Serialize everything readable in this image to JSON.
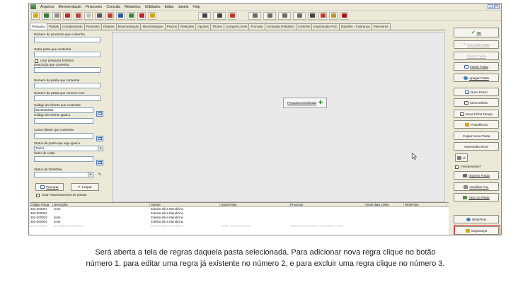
{
  "menu": [
    "Arquivos",
    "Movimentação",
    "Financeiro",
    "Consulta",
    "Relatórios",
    "Utilidades",
    "Editar",
    "Janela",
    "Help"
  ],
  "window_buttons": [
    "_",
    "□"
  ],
  "tabs": [
    "Pesquisa",
    "Pastas",
    "Complemento",
    "Processo",
    "Objetos",
    "Movimentação",
    "Mov.Destaque",
    "Prazos",
    "Relações",
    "Opções",
    "Títulos",
    "Campos Livres",
    "Formato",
    "Anotação Relatório",
    "Controle",
    "Importação PUC",
    "Espelho - Cobrança",
    "Pareceres"
  ],
  "search": {
    "num_processo_label": "Número do processo que contenha",
    "outra_parte_label": "Outra parte que contenha",
    "fonetica_label": "Usar pesquisa fonética",
    "descricao_label": "Descrição que contenha",
    "num_pasta_label": "Número da pasta que contenha",
    "num_pasta_comeca_label": "Número da pasta que comece com",
    "cod_cliente_label": "Código do Cliente que contenha",
    "cod_cliente_value": "8018040691",
    "cod_cliente_igual_label": "Código do Cliente igual a",
    "conta_cliente_label": "Conta cliente que contenha",
    "status_label": "Status da pasta que seja igual a",
    "status_value": "Todos",
    "setor_label": "Setor de custo",
    "workflow_label": "Status do Workflow",
    "procurar_label": "Procurar",
    "limpar_label": "Limpar",
    "relacionamento_label": "Usar relacionamento de pastas",
    "pesquisa_detalhada_label": "Pesquisa Detalhada"
  },
  "grid": {
    "headers": [
      "Código Pasta",
      "Descrição",
      "Cliente",
      "Outra Parte",
      "Processo",
      "Work data Limite",
      "WorkFlow"
    ],
    "rows": [
      {
        "codigo": "353-000001",
        "descricao": "teste",
        "cliente": "Zuleika Silva Mendicino",
        "outra": "",
        "processo": ""
      },
      {
        "codigo": "353-000002",
        "descricao": "",
        "cliente": "Zuleika Silva Mendicino",
        "outra": "",
        "processo": ""
      },
      {
        "codigo": "353-000003",
        "descricao": "teste",
        "cliente": "Zuleika Silva Mendicino",
        "outra": "",
        "processo": ""
      },
      {
        "codigo": "353-000004",
        "descricao": "teste",
        "cliente": "Zuleika Silva Mendicino",
        "outra": "",
        "processo": ""
      },
      {
        "codigo": "353-000005",
        "descricao": "Revisão de Benefício",
        "cliente": "Zuleika Silva Mendicino",
        "outra": "INSS - Belo Horizonte",
        "processo": "28.434.012.4.0000.7.51.1.6000.1.36.5"
      }
    ]
  },
  "right_buttons": {
    "ok": "OK",
    "cancelar": "Cancelar Pasta",
    "gravar": "Gravar Pasta",
    "inserir": "Inserir Pasta",
    "apagar": "Apagar Pasta",
    "novo_prazo": "Novo Prazo",
    "novo_debito": "Novo Débito",
    "nova_ficha": "Nova Ficha Tempo",
    "providencia": "Providência",
    "copiar": "Copiar Nova Pasta",
    "impressao_word": "Impressão Word",
    "r": "R",
    "frente_verso": "Frente/Verso?",
    "imprimir": "Imprimir Pasta",
    "atualizar": "Atualizar Arq.",
    "ged": "GED da Pasta",
    "workflow": "WorkFlow",
    "seguranca": "Segurança"
  },
  "caption": {
    "line1": "Será aberta a tela de regras daquela pasta selecionada. Para adicionar nova regra clique no botão",
    "line2": "número 1, para editar uma regra já existente no número 2, e para excluir uma regra clique no número 3."
  },
  "colors": {
    "highlight": "#e03030",
    "accent_green": "#2e9e2e",
    "accent_blue": "#3e63a0"
  }
}
